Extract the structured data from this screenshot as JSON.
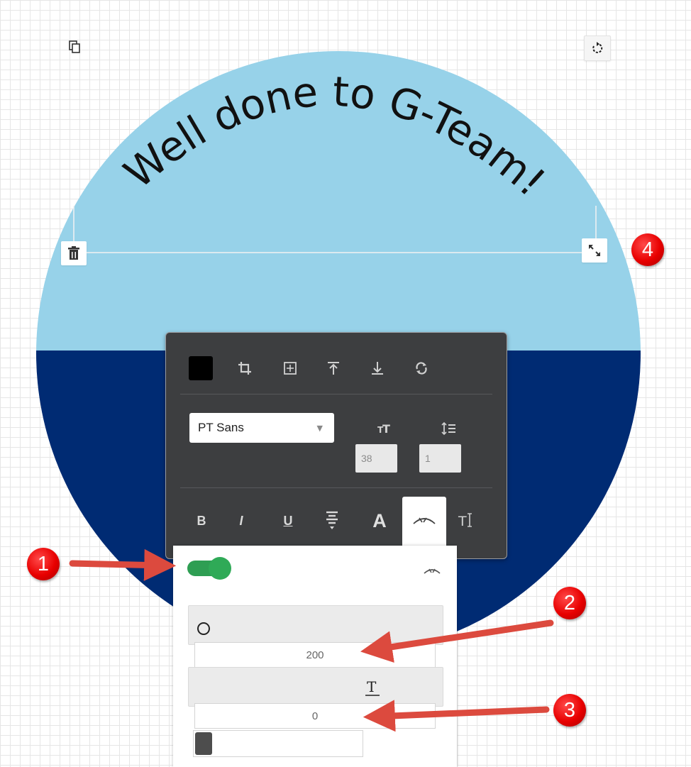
{
  "design": {
    "curved_text": "Well done to G-Team!",
    "colors": {
      "sky": "#97d2e9",
      "navy": "#002b73",
      "text": "#111111"
    }
  },
  "canvas_controls": [
    {
      "name": "duplicate-icon"
    },
    {
      "name": "rotate-icon"
    },
    {
      "name": "trash-icon"
    },
    {
      "name": "resize-icon"
    }
  ],
  "toolbar": {
    "text_color": "#000000",
    "row1_icons": [
      "crop-icon",
      "center-icon",
      "align-top-icon",
      "align-bottom-icon",
      "flip-icon"
    ],
    "font_family": "PT Sans",
    "font_size": "38",
    "line_height": "1",
    "format_buttons": {
      "bold": "B",
      "italic": "I",
      "underline": "U",
      "outline": "A"
    }
  },
  "curve_panel": {
    "enabled": true,
    "radius": "200",
    "spacing": "0",
    "stroke_color": "#4d4d4d"
  },
  "annotations": [
    "1",
    "2",
    "3",
    "4"
  ]
}
